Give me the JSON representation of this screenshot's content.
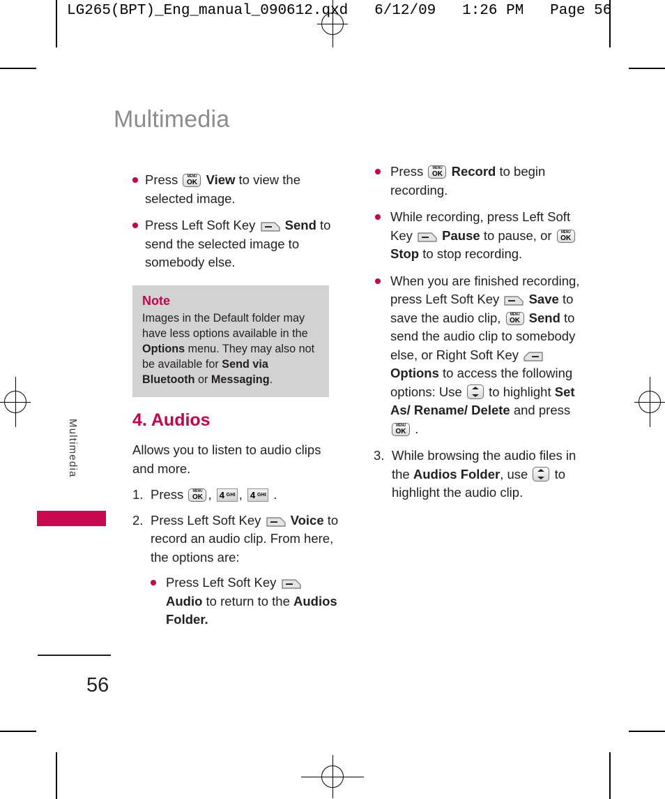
{
  "slug": "LG265(BPT)_Eng_manual_090612.qxd   6/12/09   1:26 PM   Page 56",
  "page_title": "Multimedia",
  "side_tab_label": "Multimedia",
  "page_number": "56",
  "colors": {
    "accent_magenta": "#c9004b",
    "tab_magenta": "#c90a50",
    "title_gray": "#8c8c8c",
    "note_bg": "#d2d2d2"
  },
  "icons": {
    "menu_ok": {
      "top": "MENU",
      "bottom": "OK",
      "name": "menu-ok-key-icon"
    },
    "left_soft": {
      "name": "left-soft-key-icon"
    },
    "right_soft": {
      "name": "right-soft-key-icon"
    },
    "nav_updown": {
      "name": "navigation-up-down-key-icon"
    },
    "key4": {
      "digit": "4",
      "letters": "GHI",
      "name": "keypad-4-ghi-icon"
    }
  },
  "left_column": {
    "bullets": [
      {
        "id": "bullet-view",
        "parts": [
          {
            "t": "text",
            "v": "Press "
          },
          {
            "t": "icon",
            "v": "menu_ok"
          },
          {
            "t": "bold",
            "v": " View"
          },
          {
            "t": "text",
            "v": " to view the selected image."
          }
        ]
      },
      {
        "id": "bullet-send",
        "parts": [
          {
            "t": "text",
            "v": "Press Left Soft Key "
          },
          {
            "t": "icon",
            "v": "left_soft"
          },
          {
            "t": "bold",
            "v": " Send"
          },
          {
            "t": "text",
            "v": " to send the selected image to somebody else."
          }
        ]
      }
    ]
  },
  "note": {
    "title": "Note",
    "body_parts": [
      {
        "t": "text",
        "v": "Images in the Default folder may have less options available in the "
      },
      {
        "t": "bold",
        "v": "Options"
      },
      {
        "t": "text",
        "v": " menu. They may also not be available for "
      },
      {
        "t": "bold",
        "v": "Send via Bluetooth"
      },
      {
        "t": "text",
        "v": " or "
      },
      {
        "t": "bold",
        "v": "Messaging"
      },
      {
        "t": "text",
        "v": "."
      }
    ]
  },
  "section": {
    "heading": "4. Audios",
    "intro": "Allows you to listen to audio clips and more.",
    "steps": [
      {
        "id": "step-1",
        "num": "1.",
        "parts": [
          {
            "t": "text",
            "v": "Press "
          },
          {
            "t": "icon",
            "v": "menu_ok"
          },
          {
            "t": "text",
            "v": ", "
          },
          {
            "t": "icon",
            "v": "key4"
          },
          {
            "t": "text",
            "v": ", "
          },
          {
            "t": "icon",
            "v": "key4"
          },
          {
            "t": "text",
            "v": " ."
          }
        ]
      },
      {
        "id": "step-2",
        "num": "2.",
        "parts": [
          {
            "t": "text",
            "v": "Press Left Soft Key "
          },
          {
            "t": "icon",
            "v": "left_soft"
          },
          {
            "t": "bold",
            "v": " Voice"
          },
          {
            "t": "text",
            "v": " to record an audio clip. From here, the options are:"
          }
        ]
      }
    ],
    "sub_bullets": [
      {
        "id": "bullet-audio",
        "parts": [
          {
            "t": "text",
            "v": "Press Left Soft Key "
          },
          {
            "t": "icon",
            "v": "left_soft"
          },
          {
            "t": "break",
            "v": ""
          },
          {
            "t": "bold",
            "v": "Audio"
          },
          {
            "t": "text",
            "v": " to return to the "
          },
          {
            "t": "bold",
            "v": "Audios Folder."
          }
        ]
      }
    ]
  },
  "right_column": {
    "bullets": [
      {
        "id": "bullet-record",
        "parts": [
          {
            "t": "text",
            "v": "Press "
          },
          {
            "t": "icon",
            "v": "menu_ok"
          },
          {
            "t": "bold",
            "v": " Record"
          },
          {
            "t": "text",
            "v": " to begin recording."
          }
        ]
      },
      {
        "id": "bullet-pause-stop",
        "parts": [
          {
            "t": "text",
            "v": "While recording, press Left Soft Key "
          },
          {
            "t": "icon",
            "v": "left_soft"
          },
          {
            "t": "bold",
            "v": " Pause"
          },
          {
            "t": "text",
            "v": " to pause, or "
          },
          {
            "t": "icon",
            "v": "menu_ok"
          },
          {
            "t": "bold",
            "v": " Stop"
          },
          {
            "t": "text",
            "v": " to stop recording."
          }
        ]
      },
      {
        "id": "bullet-save-send-options",
        "parts": [
          {
            "t": "text",
            "v": "When you are finished recording, press Left Soft Key "
          },
          {
            "t": "icon",
            "v": "left_soft"
          },
          {
            "t": "bold",
            "v": " Save"
          },
          {
            "t": "text",
            "v": " to save the audio clip, "
          },
          {
            "t": "icon",
            "v": "menu_ok"
          },
          {
            "t": "bold",
            "v": " Send"
          },
          {
            "t": "text",
            "v": " to send the audio clip to somebody else, or Right Soft Key "
          },
          {
            "t": "icon",
            "v": "right_soft"
          },
          {
            "t": "bold",
            "v": " Options"
          },
          {
            "t": "text",
            "v": " to access the following options: Use "
          },
          {
            "t": "icon",
            "v": "nav_updown"
          },
          {
            "t": "text",
            "v": " to highlight "
          },
          {
            "t": "bold",
            "v": "Set As/ Rename/ Delete"
          },
          {
            "t": "text",
            "v": " and press "
          },
          {
            "t": "icon",
            "v": "menu_ok"
          },
          {
            "t": "text",
            "v": " ."
          }
        ]
      }
    ],
    "steps": [
      {
        "id": "step-3",
        "num": "3.",
        "parts": [
          {
            "t": "text",
            "v": "While browsing the audio files in the "
          },
          {
            "t": "bold",
            "v": "Audios Folder"
          },
          {
            "t": "text",
            "v": ", use "
          },
          {
            "t": "icon",
            "v": "nav_updown"
          },
          {
            "t": "text",
            "v": " to highlight the audio clip."
          }
        ]
      }
    ]
  }
}
